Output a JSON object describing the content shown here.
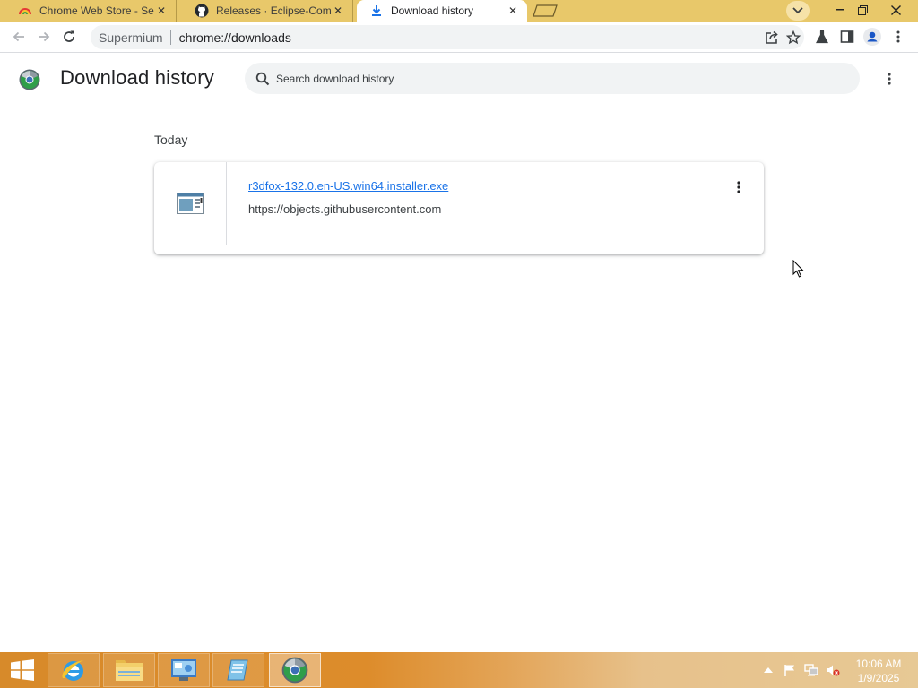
{
  "browser": {
    "tabs": [
      {
        "title": "Chrome Web Store - Se",
        "favicon": "rainbow-icon",
        "active": false
      },
      {
        "title": "Releases · Eclipse-Com",
        "favicon": "github-icon",
        "active": false
      },
      {
        "title": "Download history",
        "favicon": "download-icon",
        "active": true
      }
    ],
    "site_name": "Supermium",
    "url": "chrome://downloads"
  },
  "downloads_page": {
    "title": "Download history",
    "search_placeholder": "Search download history",
    "section_date": "Today",
    "items": [
      {
        "file_name": "r3dfox-132.0.en-US.win64.installer.exe",
        "source": "https://objects.githubusercontent.com",
        "icon": "installer-file-icon"
      }
    ]
  },
  "taskbar": {
    "apps": [
      "ie-icon",
      "file-explorer-icon",
      "control-panel-icon",
      "notepad-icon",
      "supermium-icon"
    ],
    "time": "10:06 AM",
    "date": "1/9/2025"
  },
  "colors": {
    "titlebar": "#e8c86a",
    "link": "#1a73e8",
    "taskbar": "#d78a2a"
  }
}
